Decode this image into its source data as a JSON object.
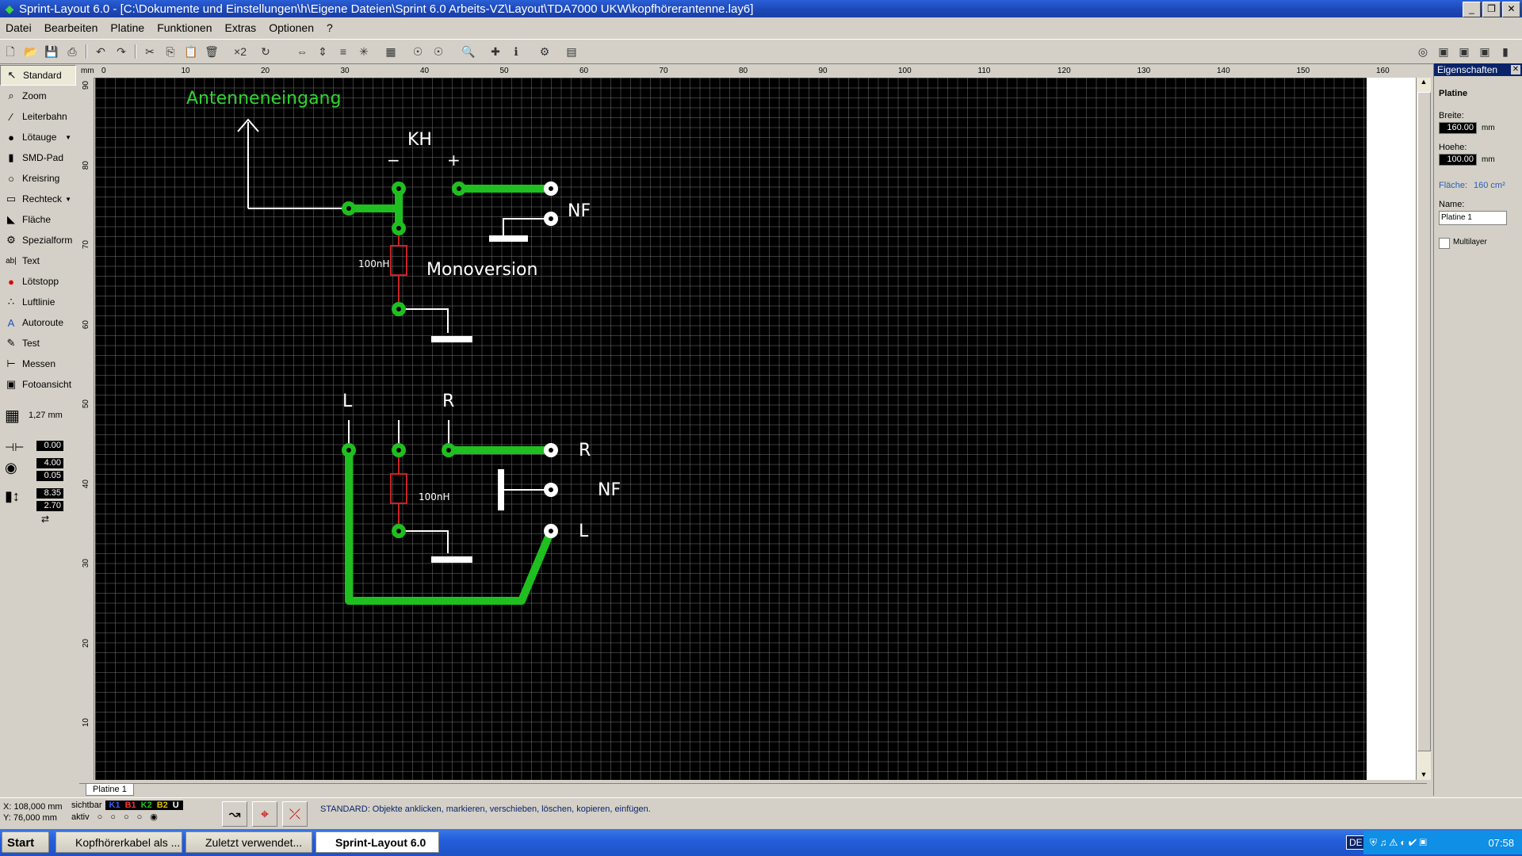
{
  "window": {
    "title": "Sprint-Layout 6.0 - [C:\\Dokumente und Einstellungen\\h\\Eigene Dateien\\Sprint 6.0 Arbeits-VZ\\Layout\\TDA7000 UKW\\kopfhörerantenne.lay6]"
  },
  "menu": [
    "Datei",
    "Bearbeiten",
    "Platine",
    "Funktionen",
    "Extras",
    "Optionen",
    "?"
  ],
  "tools": [
    {
      "label": "Standard",
      "icon": "pointer-icon"
    },
    {
      "label": "Zoom",
      "icon": "zoom-icon"
    },
    {
      "label": "Leiterbahn",
      "icon": "track-icon"
    },
    {
      "label": "Lötauge",
      "icon": "pad-icon"
    },
    {
      "label": "SMD-Pad",
      "icon": "smd-icon"
    },
    {
      "label": "Kreisring",
      "icon": "circle-icon"
    },
    {
      "label": "Rechteck",
      "icon": "rect-icon"
    },
    {
      "label": "Fläche",
      "icon": "area-icon"
    },
    {
      "label": "Spezialform",
      "icon": "special-icon"
    },
    {
      "label": "Text",
      "icon": "text-icon"
    },
    {
      "label": "Lötstopp",
      "icon": "soldermask-icon"
    },
    {
      "label": "Luftlinie",
      "icon": "airwire-icon"
    },
    {
      "label": "Autoroute",
      "icon": "autoroute-icon"
    },
    {
      "label": "Test",
      "icon": "test-icon"
    },
    {
      "label": "Messen",
      "icon": "measure-icon"
    },
    {
      "label": "Fotoansicht",
      "icon": "photo-icon"
    }
  ],
  "grid": {
    "value": "1,27 mm"
  },
  "track_settings": {
    "v1": "0.00",
    "v2": "4.00",
    "v3": "0.05",
    "v4": "8.35",
    "v5": "2.70"
  },
  "ruler": {
    "unit": "mm",
    "top": [
      "0",
      "10",
      "20",
      "30",
      "40",
      "50",
      "60",
      "70",
      "80",
      "90",
      "100",
      "110",
      "120",
      "130",
      "140",
      "150",
      "160"
    ],
    "left": [
      "90",
      "80",
      "70",
      "60",
      "50",
      "40",
      "30",
      "20",
      "10"
    ]
  },
  "canvas_text": {
    "antenna": "Antenneneingang",
    "kh": "KH",
    "minus": "−",
    "plus": "+",
    "nf1": "NF",
    "r100_1": "100nH",
    "monoversion": "Monoversion",
    "l_top": "L",
    "r_top": "R",
    "r_right": "R",
    "nf2": "NF",
    "r100_2": "100nH",
    "l_right": "L"
  },
  "properties": {
    "header": "Eigenschaften",
    "section": "Platine",
    "breite_label": "Breite:",
    "breite": "160.00",
    "hoehe_label": "Hoehe:",
    "hoehe": "100.00",
    "unit": "mm",
    "flaeche_label": "Fläche:",
    "flaeche": "160 cm²",
    "name_label": "Name:",
    "name": "Platine 1",
    "multilayer": "Multilayer"
  },
  "tabs": [
    "Platine 1"
  ],
  "status": {
    "x": "X:  108,000 mm",
    "y": "Y:    76,000 mm",
    "sichtbar": "sichtbar",
    "aktiv": "aktiv",
    "layers": [
      {
        "name": "K1",
        "color": "#3a5fff"
      },
      {
        "name": "B1",
        "color": "#ff3030"
      },
      {
        "name": "K2",
        "color": "#20c020"
      },
      {
        "name": "B2",
        "color": "#e0c000"
      },
      {
        "name": "U",
        "color": "#ffffff"
      }
    ],
    "message": "STANDARD:  Objekte anklicken, markieren, verschieben, löschen, kopieren, einfügen."
  },
  "taskbar": {
    "start": "Start",
    "tasks": [
      "Kopfhörerkabel als ...",
      "Zuletzt verwendet...",
      "Sprint-Layout 6.0"
    ],
    "lang": "DE",
    "time": "07:58"
  },
  "colors": {
    "track": "#1fbf1f",
    "resistor": "#cc2222",
    "silk": "#ffffff",
    "antenna_text": "#2fd62f"
  }
}
